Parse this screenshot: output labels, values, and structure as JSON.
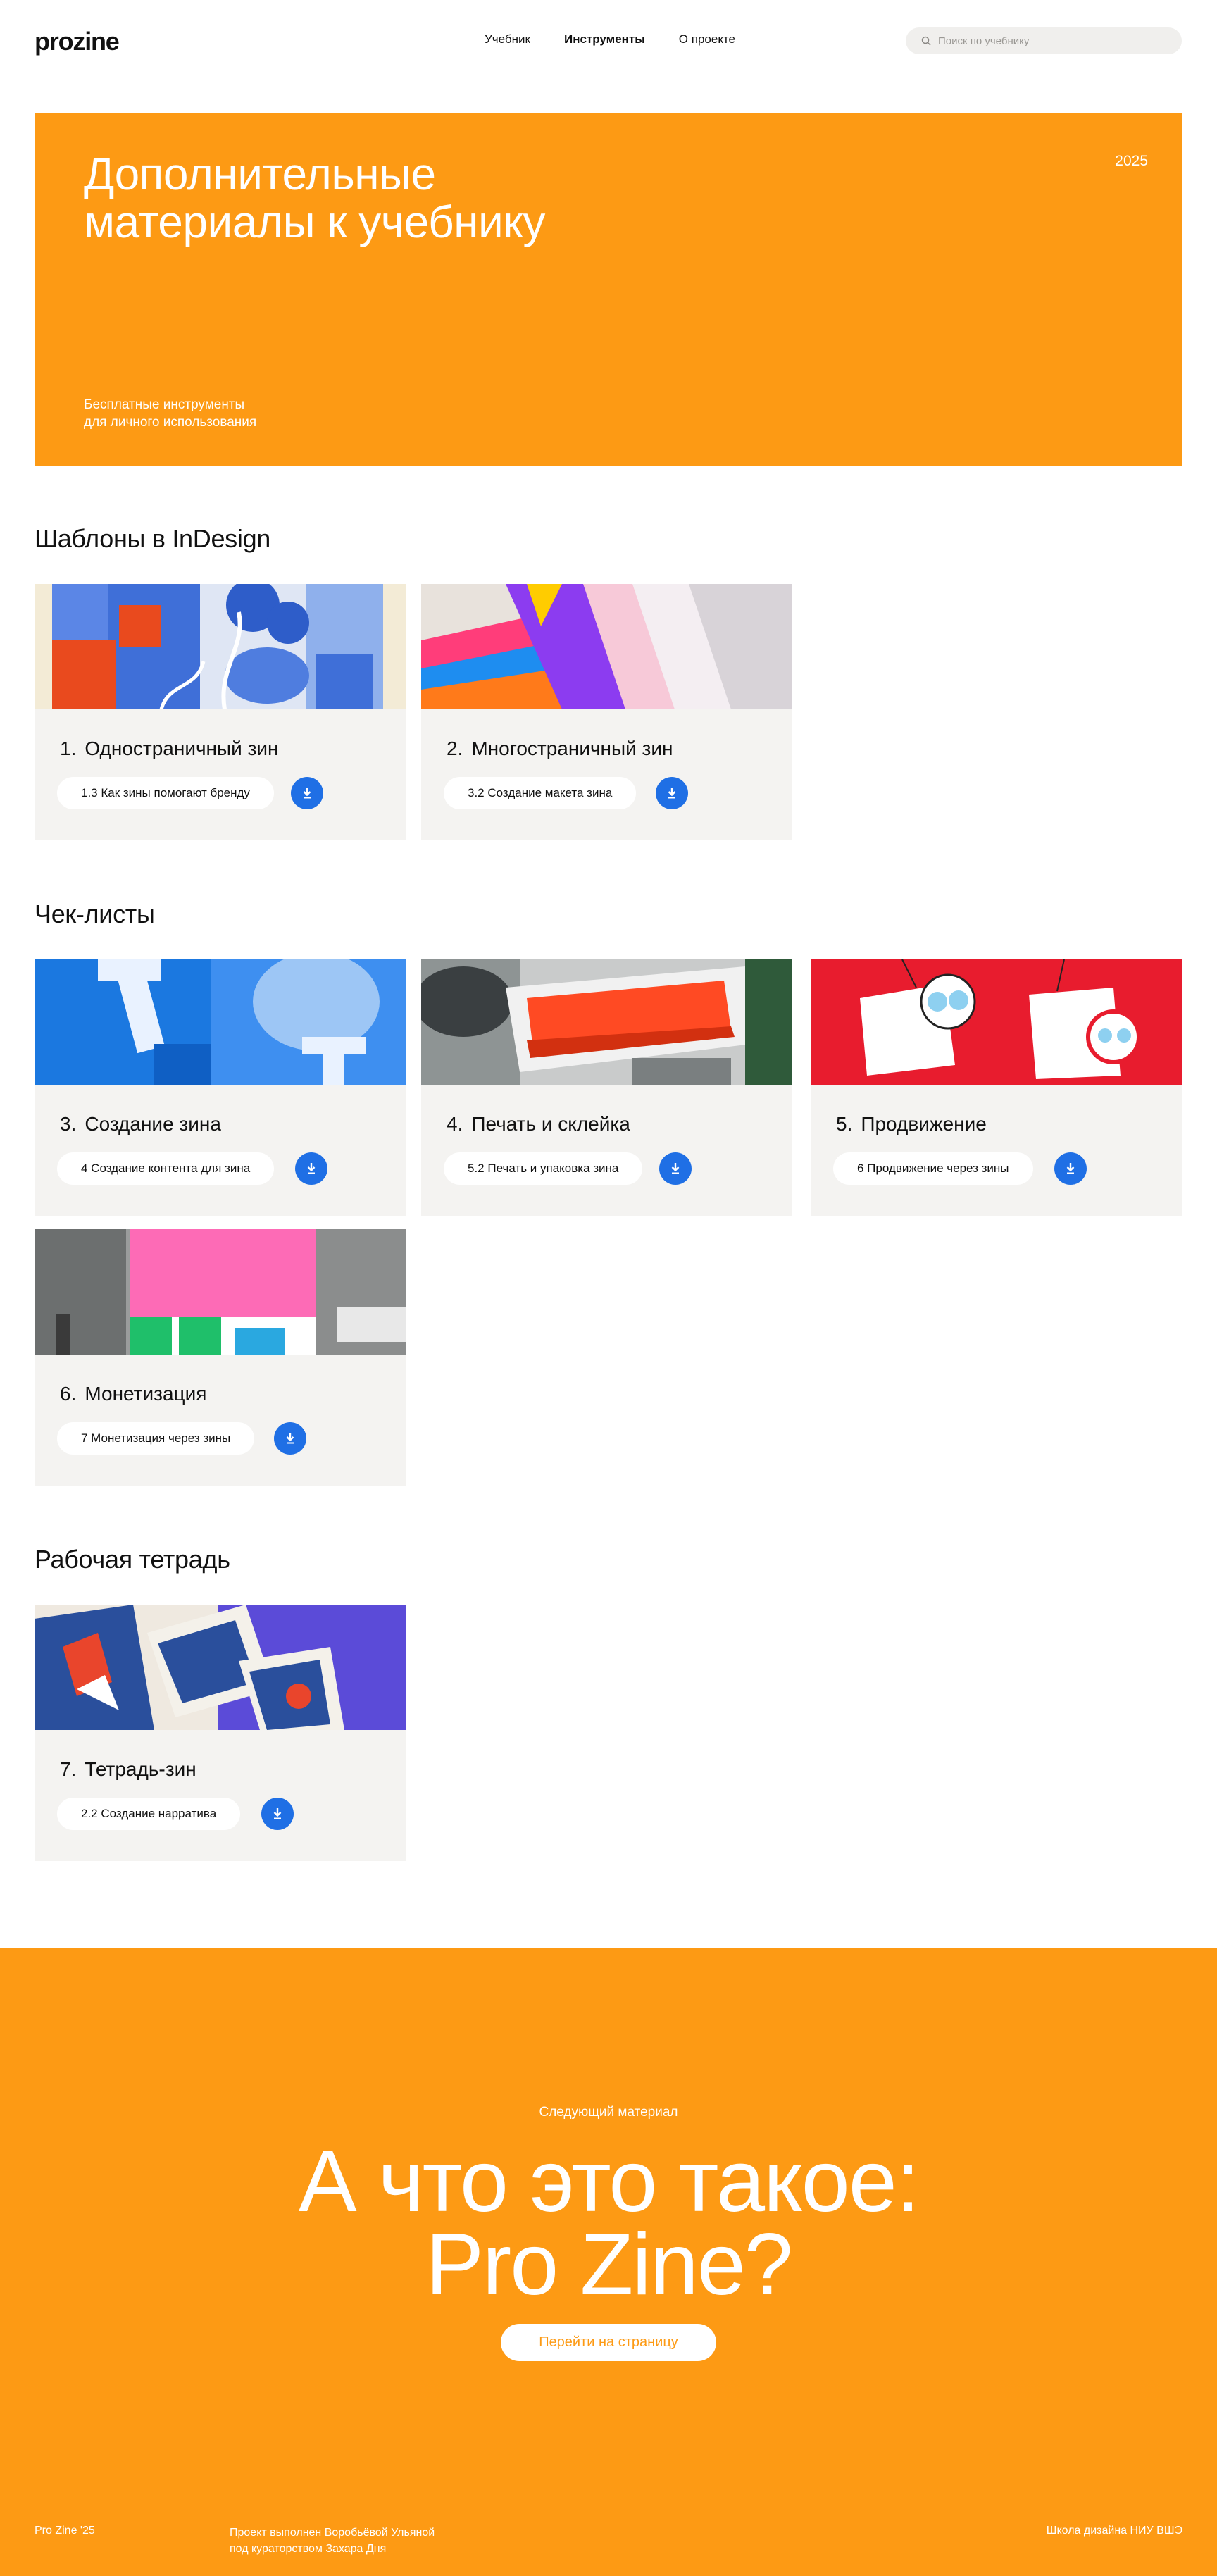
{
  "header": {
    "logo": "prozine",
    "nav": [
      "Учебник",
      "Инструменты",
      "О проекте"
    ],
    "search_placeholder": "Поиск по учебнику"
  },
  "hero": {
    "title": "Дополнительные\nматериалы к учебнику",
    "year": "2025",
    "subtitle": "Бесплатные инструменты\nдля личного использования"
  },
  "sections": [
    {
      "title": "Шаблоны в InDesign",
      "cards": [
        {
          "num": "1.",
          "title": "Одностраничный зин",
          "pill": "1.3 Как зины помогают бренду",
          "image": "blue-red-pattern-zine"
        },
        {
          "num": "2.",
          "title": "Многостраничный зин",
          "pill": "3.2 Создание макета зина",
          "image": "colorful-pages-fan"
        }
      ]
    },
    {
      "title": "Чек-листы",
      "cards": [
        {
          "num": "3.",
          "title": "Создание зина",
          "pill": "4 Создание контента для зина",
          "image": "blue-halftone-print"
        },
        {
          "num": "4.",
          "title": "Печать и склейка",
          "pill": "5.2 Печать и упаковка зина",
          "image": "risograph-drum"
        },
        {
          "num": "5.",
          "title": "Продвижение",
          "pill": "6 Продвижение через зины",
          "image": "character-tags-on-red"
        },
        {
          "num": "6.",
          "title": "Монетизация",
          "pill": "7 Монетизация через зины",
          "image": "pink-poster-street"
        }
      ]
    },
    {
      "title": "Рабочая тетрадь",
      "cards": [
        {
          "num": "7.",
          "title": "Тетрадь-зин",
          "pill": "2.2 Создание нарратива",
          "image": "printed-cards-on-blue"
        }
      ]
    }
  ],
  "next": {
    "label": "Следующий материал",
    "title": "А что это такое:\nPro Zine?",
    "button": "Перейти на страницу"
  },
  "footer": {
    "left": "Pro Zine '25",
    "middle": "Проект выполнен Воробьёвой Ульяной\nпод кураторством Захара Дня",
    "right": "Школа дизайна НИУ ВШЭ"
  },
  "colors": {
    "accent": "#fd9a14",
    "download": "#1f6fe5",
    "card_bg": "#f4f3f1"
  }
}
